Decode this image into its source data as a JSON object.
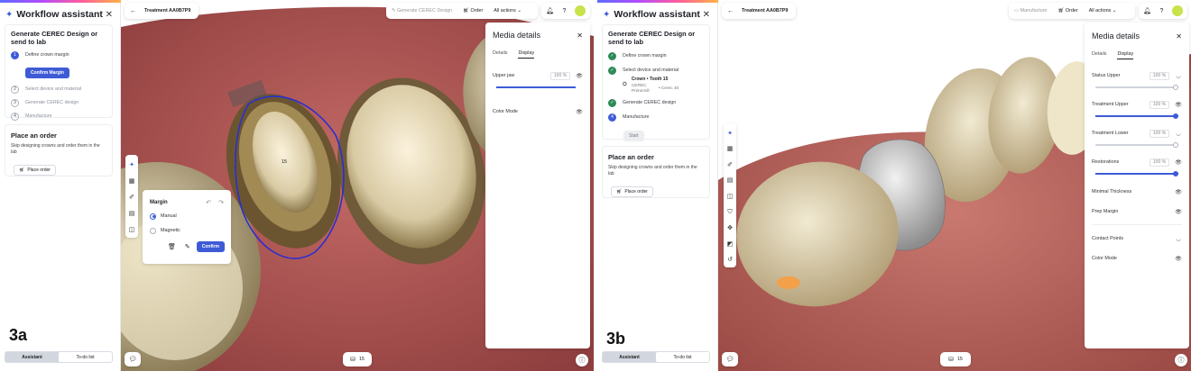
{
  "sidebar": {
    "title": "Workflow assistant",
    "section_title": "Generate CEREC Design or send to lab",
    "order_title": "Place an order",
    "order_text": "Skip designing crowns and order them in the lab",
    "place_order_label": "Place order",
    "tabs": [
      "Assistant",
      "To-do list"
    ]
  },
  "screen_a": {
    "label": "3a",
    "treatment": "Treatment AA0B7P9",
    "toolbar": {
      "generate": "Generate CEREC Design",
      "order": "Order",
      "all_actions": "All actions"
    },
    "steps": [
      {
        "num": "1",
        "label": "Define crown margin"
      },
      {
        "num": "2",
        "label": "Select device and material"
      },
      {
        "num": "3",
        "label": "Generate CEREC design"
      },
      {
        "num": "4",
        "label": "Manufacture"
      }
    ],
    "confirm_margin_label": "Confirm Margin",
    "tooth_label": "15",
    "margin_popup": {
      "title": "Margin",
      "options": [
        "Manual",
        "Magnetic"
      ],
      "confirm_label": "Confirm"
    },
    "bottom_chip": "15",
    "media": {
      "title": "Media details",
      "tabs": [
        "Details",
        "Display"
      ],
      "rows": [
        {
          "label": "Upper jaw",
          "pct": "100 %",
          "level": 1.0
        },
        {
          "label": "Color Mode"
        }
      ]
    }
  },
  "screen_b": {
    "label": "3b",
    "treatment": "Treatment AA0B7P9",
    "toolbar": {
      "manufacture": "Manufacture",
      "order": "Order",
      "all_actions": "All actions"
    },
    "steps": [
      {
        "num": "✓",
        "label": "Define crown margin"
      },
      {
        "num": "✓",
        "label": "Select device and material"
      },
      {
        "num": "✓",
        "label": "Generate CEREC design"
      },
      {
        "num": "4",
        "label": "Manufacture"
      }
    ],
    "material": {
      "title": "Crown • Tooth 15",
      "brand": "CEREC Primemill",
      "device": "• Cerec 40"
    },
    "start_label": "Start",
    "bottom_chip": "15",
    "media": {
      "title": "Media details",
      "tabs": [
        "Details",
        "Display"
      ],
      "rows": [
        {
          "label": "Status Upper",
          "pct": "100 %",
          "level": 1.0
        },
        {
          "label": "Treatment Upper",
          "pct": "100 %",
          "level": 1.0
        },
        {
          "label": "Treatment Lower",
          "pct": "100 %",
          "level": 1.0
        },
        {
          "label": "Restorations",
          "pct": "100 %",
          "level": 1.0
        },
        {
          "label": "Minimal Thickness"
        },
        {
          "label": "Prep Margin"
        },
        {
          "label": "Contact Points"
        },
        {
          "label": "Color Mode"
        }
      ]
    }
  },
  "colors": {
    "accent": "#3e5bd6",
    "done": "#2e8b57",
    "margin_line": "#2a2fd0"
  }
}
